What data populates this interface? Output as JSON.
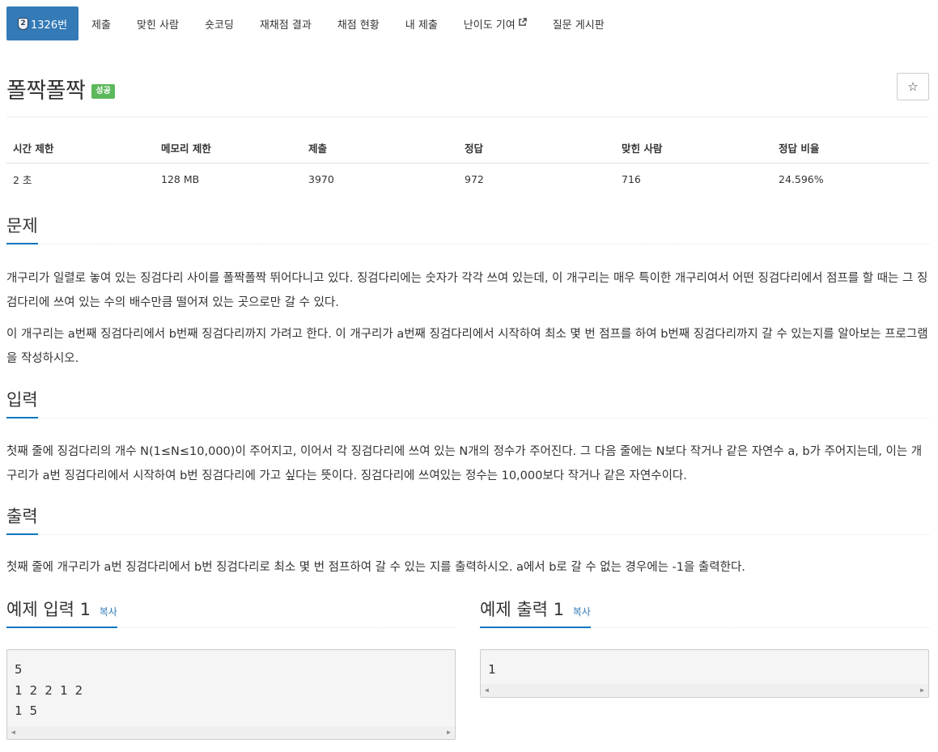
{
  "nav": {
    "problem_number": "1326번",
    "tier_icon_text": "2",
    "items": [
      "제출",
      "맞힌 사람",
      "숏코딩",
      "재채점 결과",
      "채점 현황",
      "내 제출",
      "난이도 기여",
      "질문 게시판"
    ]
  },
  "title": "폴짝폴짝",
  "badge": "성공",
  "star_icon": "☆",
  "stats": {
    "headers": [
      "시간 제한",
      "메모리 제한",
      "제출",
      "정답",
      "맞힌 사람",
      "정답 비율"
    ],
    "values": [
      "2 초",
      "128 MB",
      "3970",
      "972",
      "716",
      "24.596%"
    ]
  },
  "sections": {
    "problem": {
      "heading": "문제",
      "paragraphs": [
        "개구리가 일렬로 놓여 있는 징검다리 사이를 폴짝폴짝 뛰어다니고 있다. 징검다리에는 숫자가 각각 쓰여 있는데, 이 개구리는 매우 특이한 개구리여서 어떤 징검다리에서 점프를 할 때는 그 징검다리에 쓰여 있는 수의 배수만큼 떨어져 있는 곳으로만 갈 수 있다.",
        "이 개구리는 a번째 징검다리에서 b번째 징검다리까지 가려고 한다. 이 개구리가 a번째 징검다리에서 시작하여 최소 몇 번 점프를 하여 b번째 징검다리까지 갈 수 있는지를 알아보는 프로그램을 작성하시오."
      ]
    },
    "input": {
      "heading": "입력",
      "paragraph": "첫째 줄에 징검다리의 개수 N(1≤N≤10,000)이 주어지고, 이어서 각 징검다리에 쓰여 있는 N개의 정수가 주어진다. 그 다음 줄에는 N보다 작거나 같은 자연수 a, b가 주어지는데, 이는 개구리가 a번 징검다리에서 시작하여 b번 징검다리에 가고 싶다는 뜻이다. 징검다리에 쓰여있는 정수는 10,000보다 작거나 같은 자연수이다."
    },
    "output": {
      "heading": "출력",
      "paragraph": "첫째 줄에 개구리가 a번 징검다리에서 b번 징검다리로 최소 몇 번 점프하여 갈 수 있는 지를 출력하시오. a에서 b로 갈 수 없는 경우에는 -1을 출력한다."
    }
  },
  "samples": {
    "input_heading": "예제 입력 1",
    "output_heading": "예제 출력 1",
    "copy_label": "복사",
    "input_text": "5\n1 2 2 1 2\n1 5",
    "output_text": "1"
  }
}
